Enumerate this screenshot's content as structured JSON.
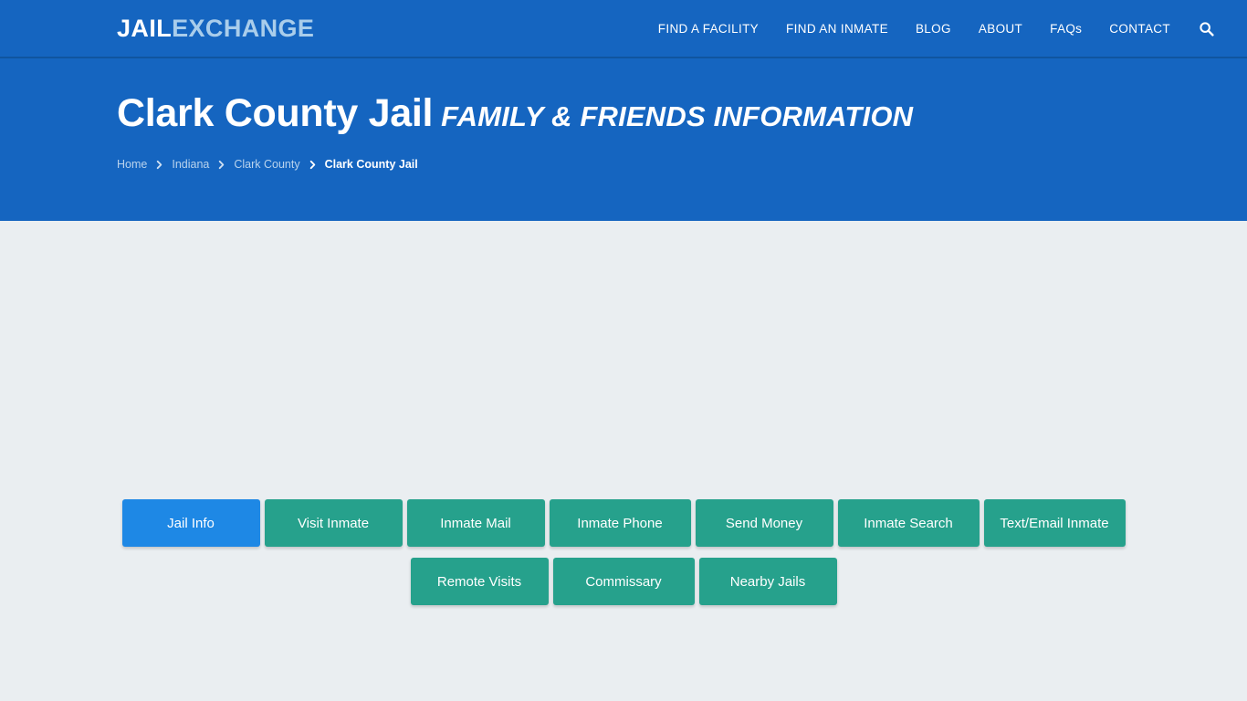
{
  "site": {
    "logo_primary": "JAIL",
    "logo_secondary": "EXCHANGE",
    "brand_blue": "#1565c0",
    "accent_teal": "#26a18c",
    "active_blue": "#1e88e5",
    "page_background": "#eaeef1"
  },
  "nav": {
    "items": [
      {
        "label": "FIND A FACILITY"
      },
      {
        "label": "FIND AN INMATE"
      },
      {
        "label": "BLOG"
      },
      {
        "label": "ABOUT"
      },
      {
        "label": "FAQs"
      },
      {
        "label": "CONTACT"
      }
    ],
    "search_icon": "search-icon"
  },
  "hero": {
    "title_main": "Clark County Jail",
    "title_sub": "FAMILY & FRIENDS INFORMATION"
  },
  "breadcrumb": {
    "items": [
      {
        "label": "Home",
        "current": false
      },
      {
        "label": "Indiana",
        "current": false
      },
      {
        "label": "Clark County",
        "current": false
      },
      {
        "label": "Clark County Jail",
        "current": true
      }
    ],
    "separator_icon": "chevron-right-icon"
  },
  "tabs": {
    "row1": [
      {
        "label": "Jail Info",
        "active": true
      },
      {
        "label": "Visit Inmate",
        "active": false
      },
      {
        "label": "Inmate Mail",
        "active": false
      },
      {
        "label": "Inmate Phone",
        "active": false
      },
      {
        "label": "Send Money",
        "active": false
      },
      {
        "label": "Inmate Search",
        "active": false
      },
      {
        "label": "Text/Email Inmate",
        "active": false
      }
    ],
    "row2": [
      {
        "label": "Remote Visits",
        "active": false
      },
      {
        "label": "Commissary",
        "active": false
      },
      {
        "label": "Nearby Jails",
        "active": false
      }
    ]
  }
}
